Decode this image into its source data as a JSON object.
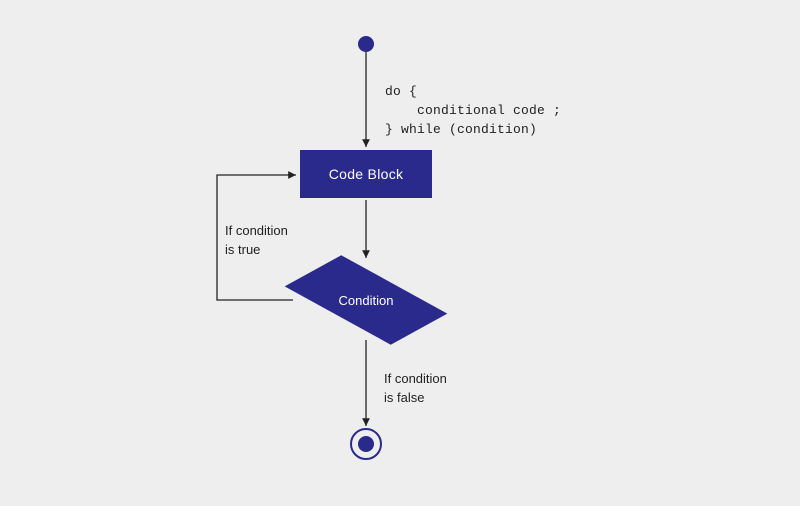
{
  "start": {
    "type": "start-circle"
  },
  "code_block": {
    "label": "Code Block"
  },
  "condition": {
    "label": "Condition"
  },
  "end": {
    "type": "end-circle"
  },
  "annotations": {
    "code_snippet": "do {\n    conditional code ;\n} while (condition)",
    "true_branch": "If condition\nis true",
    "false_branch": "If condition\nis false"
  },
  "colors": {
    "shape_fill": "#2a2a8c",
    "background": "#eeeeee",
    "text": "#222222",
    "shape_text": "#ffffff"
  },
  "flow": [
    {
      "from": "start",
      "to": "code_block"
    },
    {
      "from": "code_block",
      "to": "condition"
    },
    {
      "from": "condition",
      "to": "code_block",
      "when": "true",
      "path": "loop-back-left"
    },
    {
      "from": "condition",
      "to": "end",
      "when": "false"
    }
  ]
}
